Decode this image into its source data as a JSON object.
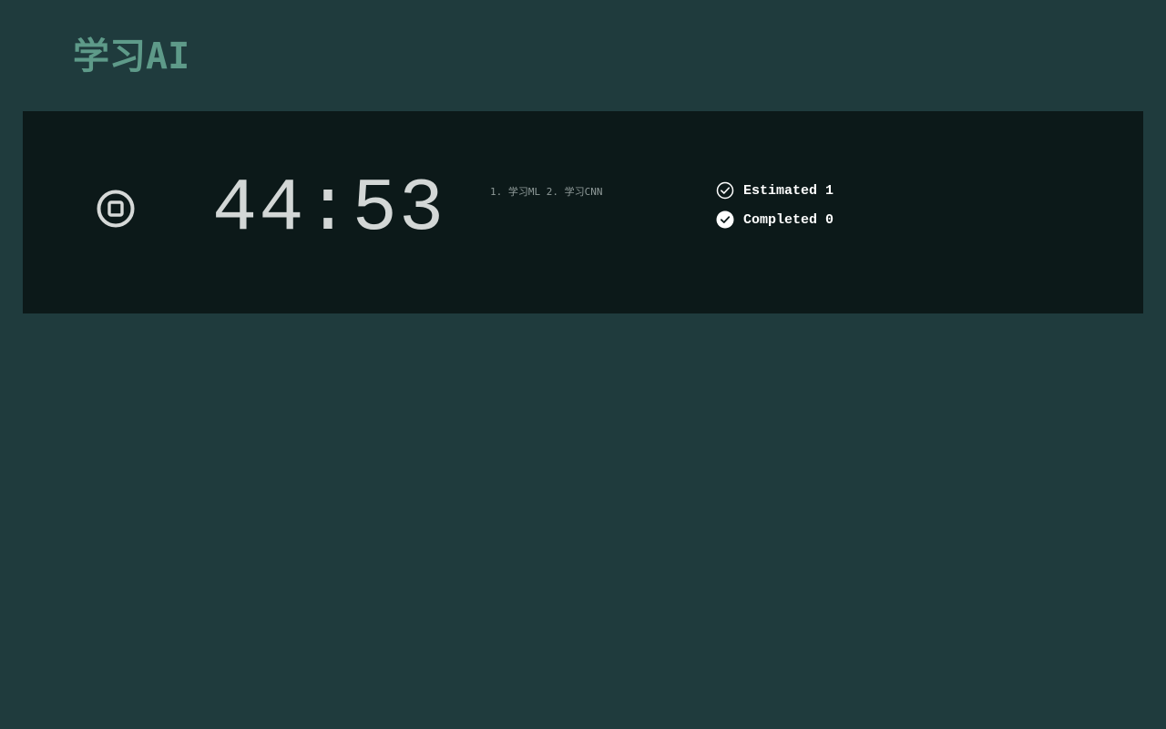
{
  "header": {
    "title": "学习AI"
  },
  "timer": {
    "display": "44:53",
    "stop_icon": "stop-circle-icon"
  },
  "tasks": {
    "text": "1. 学习ML 2. 学习CNN"
  },
  "stats": {
    "estimated_label": "Estimated 1",
    "estimated_icon": "check-circle-outline-icon",
    "completed_label": "Completed 0",
    "completed_icon": "check-circle-filled-icon"
  },
  "colors": {
    "background": "#1f3b3d",
    "panel": "#0c1919",
    "title_accent": "#5e9a89",
    "timer_text": "#d3d7d6",
    "stat_text": "#ffffff"
  }
}
